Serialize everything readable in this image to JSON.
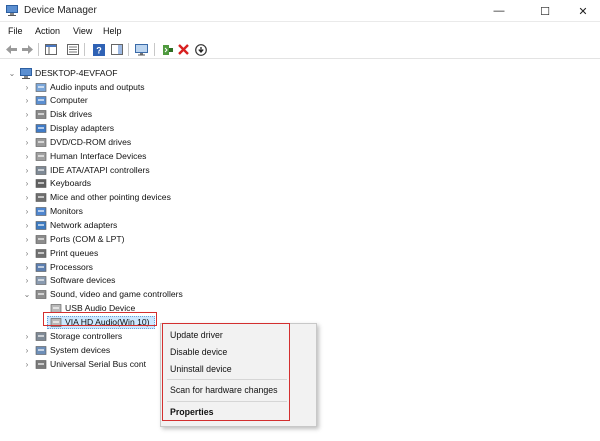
{
  "window": {
    "title": "Device Manager",
    "controls": {
      "minimize": "—",
      "maximize": "☐",
      "close": "✕"
    }
  },
  "menu": [
    "File",
    "Action",
    "View",
    "Help"
  ],
  "toolbar": {
    "buttons": [
      "back-icon",
      "forward-icon",
      "show-hide-console-tree-icon",
      "properties-icon",
      "help-icon",
      "action-pane-icon",
      "monitor-icon",
      "update-driver-icon",
      "uninstall-icon",
      "download-icon"
    ]
  },
  "tree": {
    "root": "DESKTOP-4EVFAOF",
    "categories": [
      "Audio inputs and outputs",
      "Computer",
      "Disk drives",
      "Display adapters",
      "DVD/CD-ROM drives",
      "Human Interface Devices",
      "IDE ATA/ATAPI controllers",
      "Keyboards",
      "Mice and other pointing devices",
      "Monitors",
      "Network adapters",
      "Ports (COM & LPT)",
      "Print queues",
      "Processors",
      "Software devices",
      "Sound, video and game controllers"
    ],
    "sound_children": [
      "USB Audio Device",
      "VIA HD Audio(Win 10)"
    ],
    "after": [
      "Storage controllers",
      "System devices",
      "Universal Serial Bus cont"
    ]
  },
  "context_menu": {
    "items": [
      "Update driver",
      "Disable device",
      "Uninstall device",
      "Scan for hardware changes",
      "Properties"
    ]
  },
  "colors": {
    "selection": "#cce8ff",
    "highlight_box": "#d32f2f"
  }
}
